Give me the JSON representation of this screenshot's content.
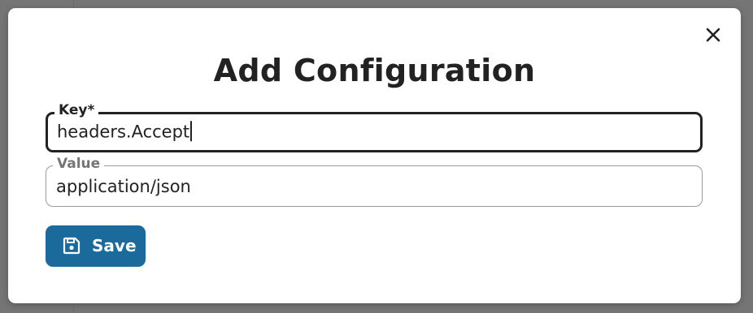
{
  "dialog": {
    "title": "Add Configuration",
    "close_icon": "close-icon"
  },
  "form": {
    "key": {
      "label": "Key*",
      "value": "headers.Accept"
    },
    "value": {
      "label": "Value",
      "value": "application/json"
    }
  },
  "actions": {
    "save_label": "Save",
    "save_icon": "floppy-disk-icon",
    "save_color": "#1a6a9c"
  }
}
